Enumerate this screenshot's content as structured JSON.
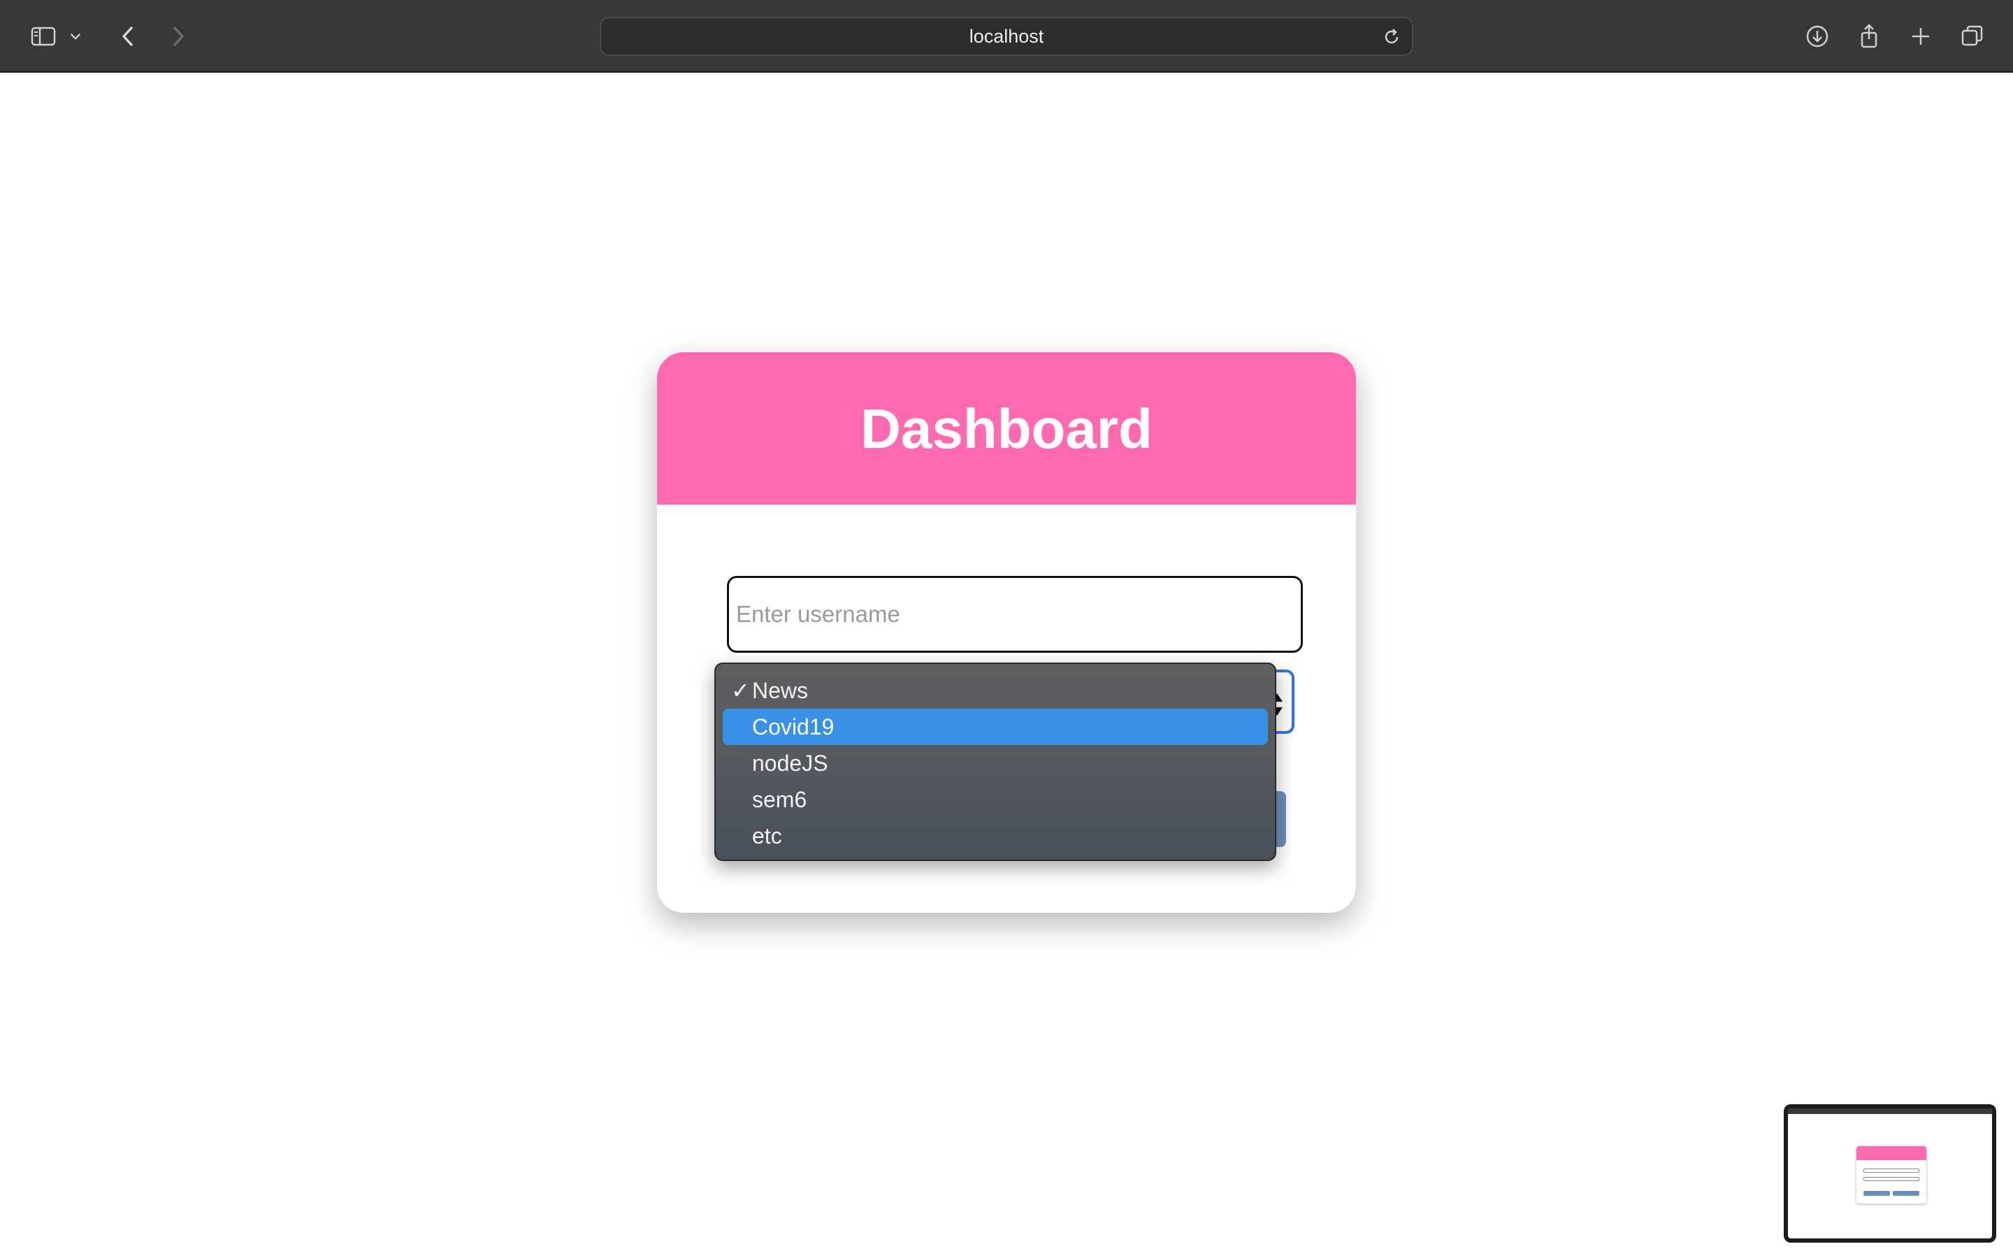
{
  "browser": {
    "url": "localhost",
    "icons": {
      "sidebar": "sidebar-icon",
      "sidebar_menu": "chevron-down-icon",
      "back": "chevron-left-icon",
      "forward": "chevron-right-icon",
      "reload": "reload-icon",
      "downloads": "download-icon",
      "share": "share-icon",
      "new_tab": "plus-icon",
      "tab_overview": "tabs-icon"
    }
  },
  "card": {
    "title": "Dashboard",
    "username_placeholder": "Enter username",
    "username_value": "",
    "header_color": "#ff69b0",
    "button_color": "#6d8fb8"
  },
  "dropdown": {
    "selected": "News",
    "highlighted": "Covid19",
    "options": [
      "News",
      "Covid19",
      "nodeJS",
      "sem6",
      "etc"
    ],
    "highlight_color": "#3891e6"
  }
}
